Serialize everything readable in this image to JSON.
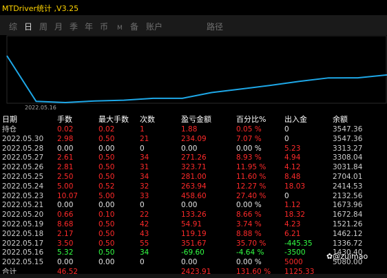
{
  "window": {
    "title": "MTDriver统计 ,V3.25"
  },
  "tabs": [
    {
      "label": "综"
    },
    {
      "label": "日"
    },
    {
      "label": "周"
    },
    {
      "label": "月"
    },
    {
      "label": "季"
    },
    {
      "label": "年"
    },
    {
      "label": "币"
    },
    {
      "label": "M"
    },
    {
      "label": "备"
    },
    {
      "label": "账户"
    },
    {
      "label": "路径"
    }
  ],
  "selected_tab": "日",
  "chart": {
    "x_label": "2022.05.16",
    "line_color": "#1ea8e8",
    "balances": [
      5080.0,
      1430.4,
      1336.72,
      1462.12,
      1521.26,
      1672.84,
      1673.96,
      2132.56,
      2414.53,
      2704.01,
      3031.84,
      3308.04,
      3313.27,
      3547.36
    ]
  },
  "table": {
    "headers": [
      "日期",
      "手数",
      "最大手数",
      "次数",
      "盈亏金额",
      "百分比%",
      "出入金",
      "余额"
    ],
    "rows": [
      {
        "date": "持仓",
        "lots": "0.02",
        "max": "0.02",
        "count": "1",
        "pnl": "1.88",
        "pct": "0.05 %",
        "flow": "0",
        "balance": "3547.36"
      },
      {
        "date": "2022.05.30",
        "lots": "2.98",
        "max": "0.50",
        "count": "21",
        "pnl": "234.09",
        "pct": "7.07 %",
        "flow": "0",
        "balance": "3547.36"
      },
      {
        "date": "2022.05.28",
        "lots": "0.00",
        "max": "0.00",
        "count": "0",
        "pnl": "0.00",
        "pct": "0.00 %",
        "flow": "5.23",
        "balance": "3313.27"
      },
      {
        "date": "2022.05.27",
        "lots": "2.61",
        "max": "0.50",
        "count": "34",
        "pnl": "271.26",
        "pct": "8.93 %",
        "flow": "4.94",
        "balance": "3308.04"
      },
      {
        "date": "2022.05.26",
        "lots": "2.81",
        "max": "0.50",
        "count": "31",
        "pnl": "323.71",
        "pct": "11.95 %",
        "flow": "4.12",
        "balance": "3031.84"
      },
      {
        "date": "2022.05.25",
        "lots": "2.50",
        "max": "0.50",
        "count": "34",
        "pnl": "281.00",
        "pct": "11.60 %",
        "flow": "8.48",
        "balance": "2704.01"
      },
      {
        "date": "2022.05.24",
        "lots": "5.00",
        "max": "0.52",
        "count": "32",
        "pnl": "263.94",
        "pct": "12.27 %",
        "flow": "18.03",
        "balance": "2414.53"
      },
      {
        "date": "2022.05.23",
        "lots": "10.07",
        "max": "5.00",
        "count": "33",
        "pnl": "458.60",
        "pct": "27.40 %",
        "flow": "0",
        "balance": "2132.56"
      },
      {
        "date": "2022.05.21",
        "lots": "0.00",
        "max": "0.00",
        "count": "0",
        "pnl": "0.00",
        "pct": "0.00 %",
        "flow": "1.12",
        "balance": "1673.96"
      },
      {
        "date": "2022.05.20",
        "lots": "0.66",
        "max": "0.10",
        "count": "22",
        "pnl": "133.26",
        "pct": "8.66 %",
        "flow": "18.32",
        "balance": "1672.84"
      },
      {
        "date": "2022.05.19",
        "lots": "8.68",
        "max": "0.50",
        "count": "42",
        "pnl": "54.91",
        "pct": "3.74 %",
        "flow": "4.23",
        "balance": "1521.26"
      },
      {
        "date": "2022.05.18",
        "lots": "2.17",
        "max": "0.50",
        "count": "43",
        "pnl": "119.19",
        "pct": "8.88 %",
        "flow": "6.21",
        "balance": "1462.12"
      },
      {
        "date": "2022.05.17",
        "lots": "3.50",
        "max": "0.50",
        "count": "55",
        "pnl": "351.67",
        "pct": "35.70 %",
        "flow": "-445.35",
        "balance": "1336.72"
      },
      {
        "date": "2022.05.16",
        "lots": "5.32",
        "max": "0.50",
        "count": "34",
        "pnl": "-69.60",
        "pct": "-4.64 %",
        "flow": "-3500",
        "balance": "1430.40"
      },
      {
        "date": "2022.05.15",
        "lots": "0.00",
        "max": "0.00",
        "count": "0",
        "pnl": "0.00",
        "pct": "0.00 %",
        "flow": "5000",
        "balance": "5080.00"
      },
      {
        "date": "合计",
        "lots": "46.52",
        "max": "",
        "count": "",
        "pnl": "2423.91",
        "pct": "131.60 %",
        "flow": "1125.33",
        "balance": ""
      }
    ],
    "row_colors": [
      "red",
      "red",
      "white",
      "red",
      "red",
      "red",
      "red",
      "red",
      "white",
      "red",
      "red",
      "red",
      "red",
      "green",
      "white",
      "red"
    ],
    "flow_colors": [
      "white",
      "white",
      "red",
      "red",
      "red",
      "red",
      "red",
      "white",
      "red",
      "red",
      "red",
      "red",
      "green",
      "green",
      "red",
      "red"
    ]
  },
  "watermark": "@zuimao"
}
